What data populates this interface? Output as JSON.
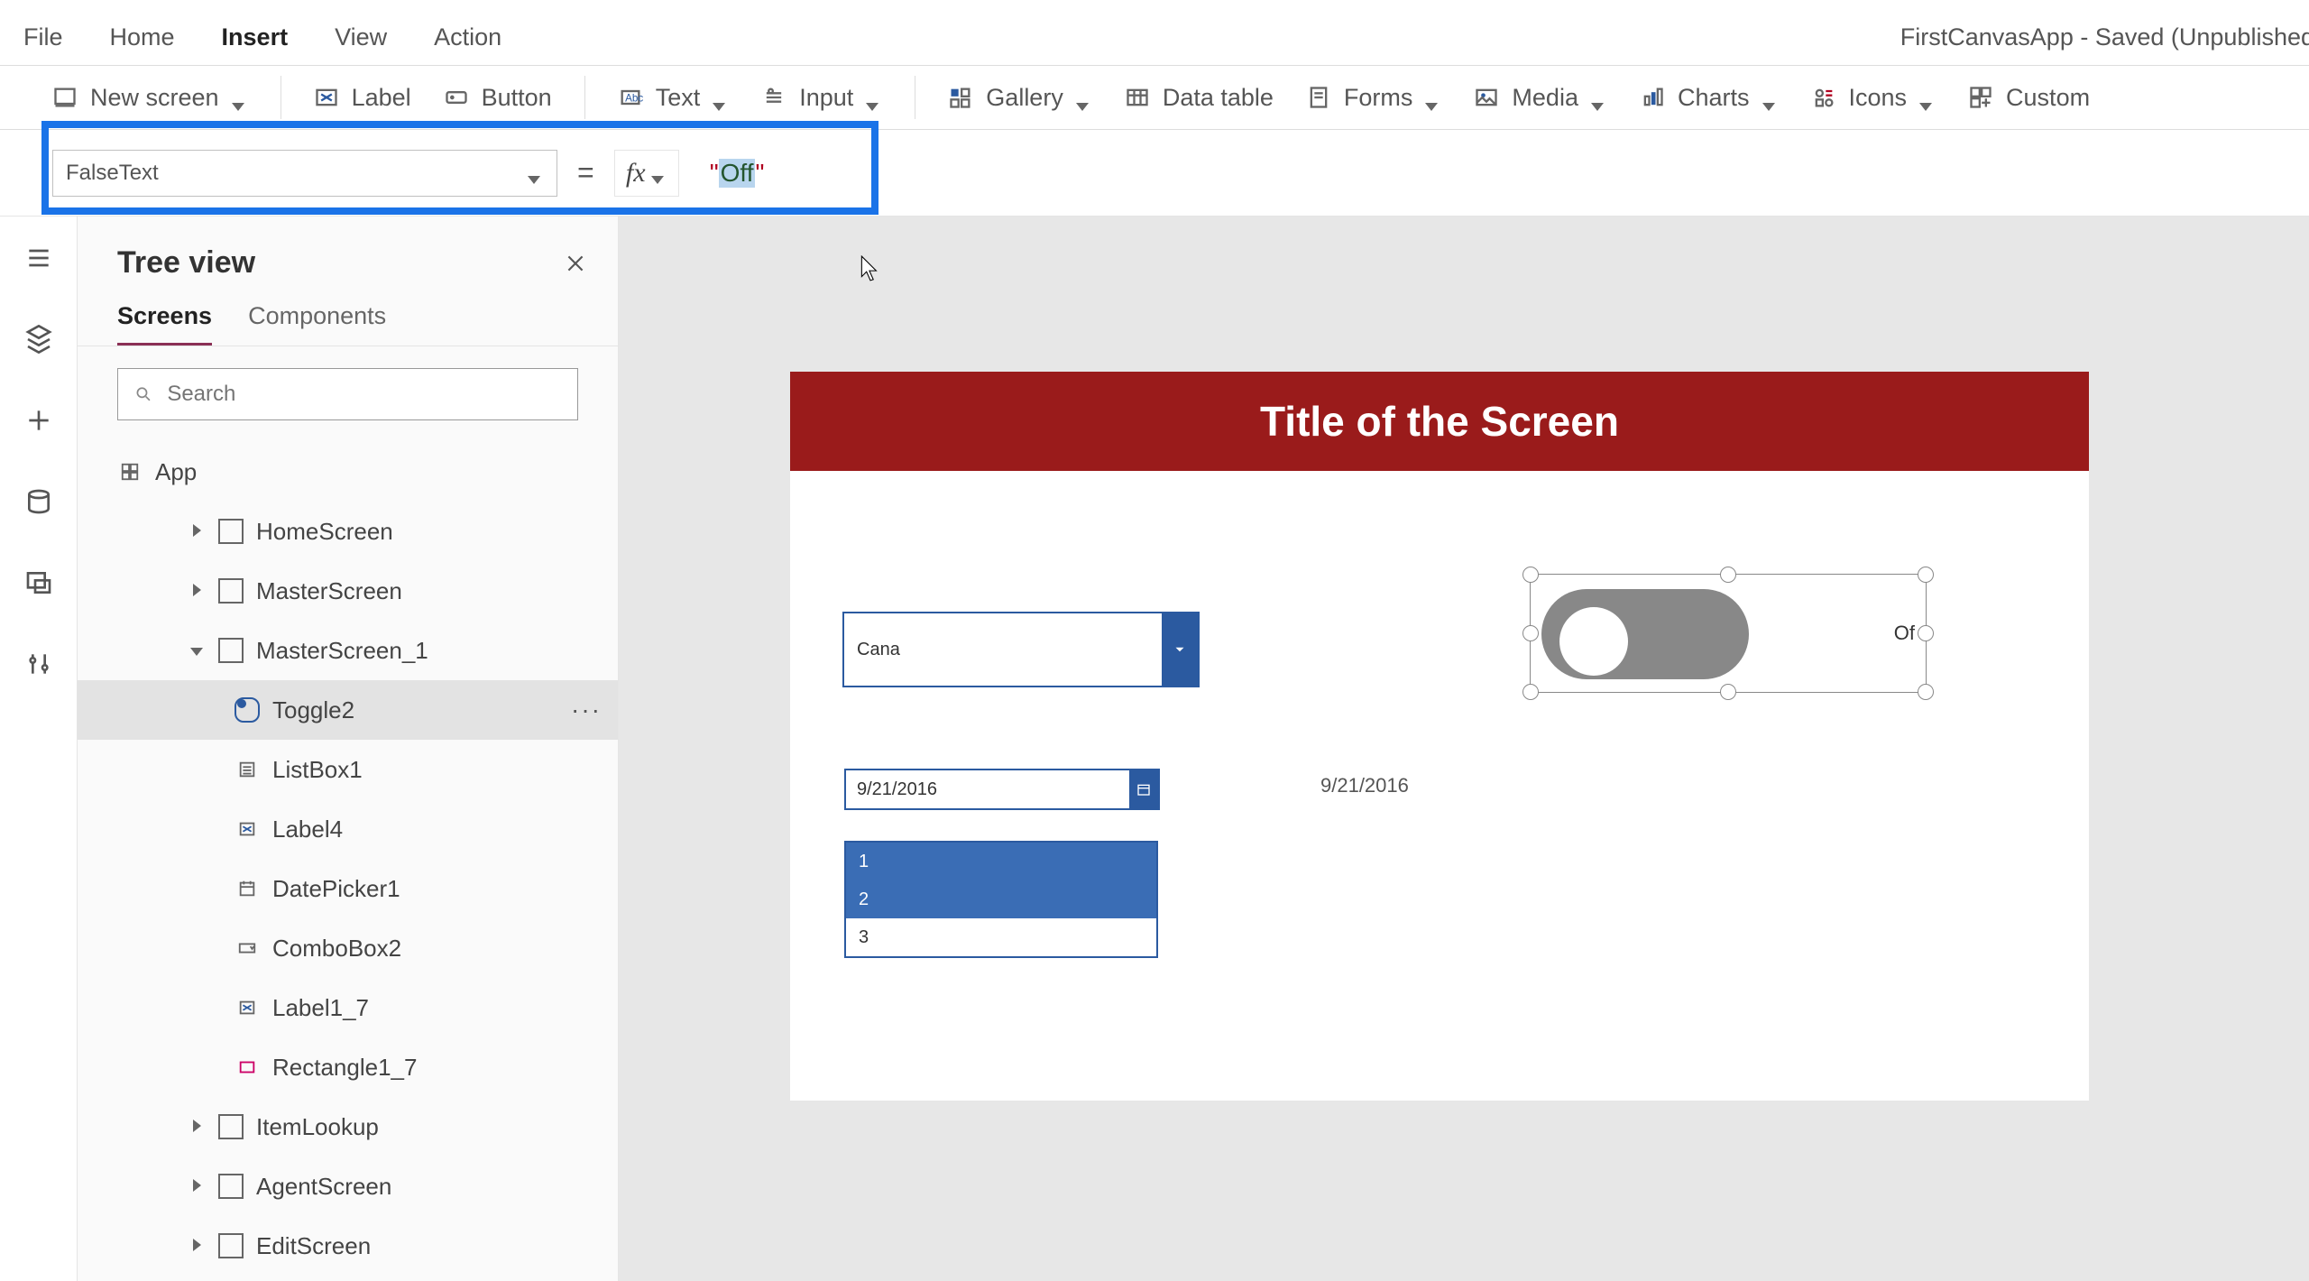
{
  "menubar": [
    "File",
    "Home",
    "Insert",
    "View",
    "Action"
  ],
  "active_menu": "Insert",
  "app_title": "FirstCanvasApp - Saved (Unpublished",
  "ribbon": {
    "new_screen": "New screen",
    "label": "Label",
    "button": "Button",
    "text": "Text",
    "input": "Input",
    "gallery": "Gallery",
    "data_table": "Data table",
    "forms": "Forms",
    "media": "Media",
    "charts": "Charts",
    "icons": "Icons",
    "custom": "Custom"
  },
  "formula": {
    "property": "FalseText",
    "fx": "fx",
    "quote": "\"",
    "value_selected": "Off"
  },
  "tree": {
    "title": "Tree view",
    "tabs": [
      "Screens",
      "Components"
    ],
    "active_tab": "Screens",
    "search_placeholder": "Search",
    "app_label": "App",
    "items": [
      {
        "label": "HomeScreen",
        "collapsed": true
      },
      {
        "label": "MasterScreen",
        "collapsed": true
      },
      {
        "label": "MasterScreen_1",
        "collapsed": false
      },
      {
        "label": "ItemLookup",
        "collapsed": true
      },
      {
        "label": "AgentScreen",
        "collapsed": true
      },
      {
        "label": "EditScreen",
        "collapsed": true
      }
    ],
    "master1_children": [
      {
        "label": "Toggle2",
        "kind": "toggle",
        "selected": true
      },
      {
        "label": "ListBox1",
        "kind": "listbox"
      },
      {
        "label": "Label4",
        "kind": "label"
      },
      {
        "label": "DatePicker1",
        "kind": "datepicker"
      },
      {
        "label": "ComboBox2",
        "kind": "combobox"
      },
      {
        "label": "Label1_7",
        "kind": "label"
      },
      {
        "label": "Rectangle1_7",
        "kind": "rect"
      }
    ]
  },
  "canvas": {
    "title": "Title of the Screen",
    "combo_value": "Cana",
    "date_value": "9/21/2016",
    "date_label": "9/21/2016",
    "list_items": [
      "1",
      "2",
      "3"
    ],
    "toggle_label": "Of",
    "title_bg": "#9a1b1b",
    "accent": "#2b5aa0"
  }
}
